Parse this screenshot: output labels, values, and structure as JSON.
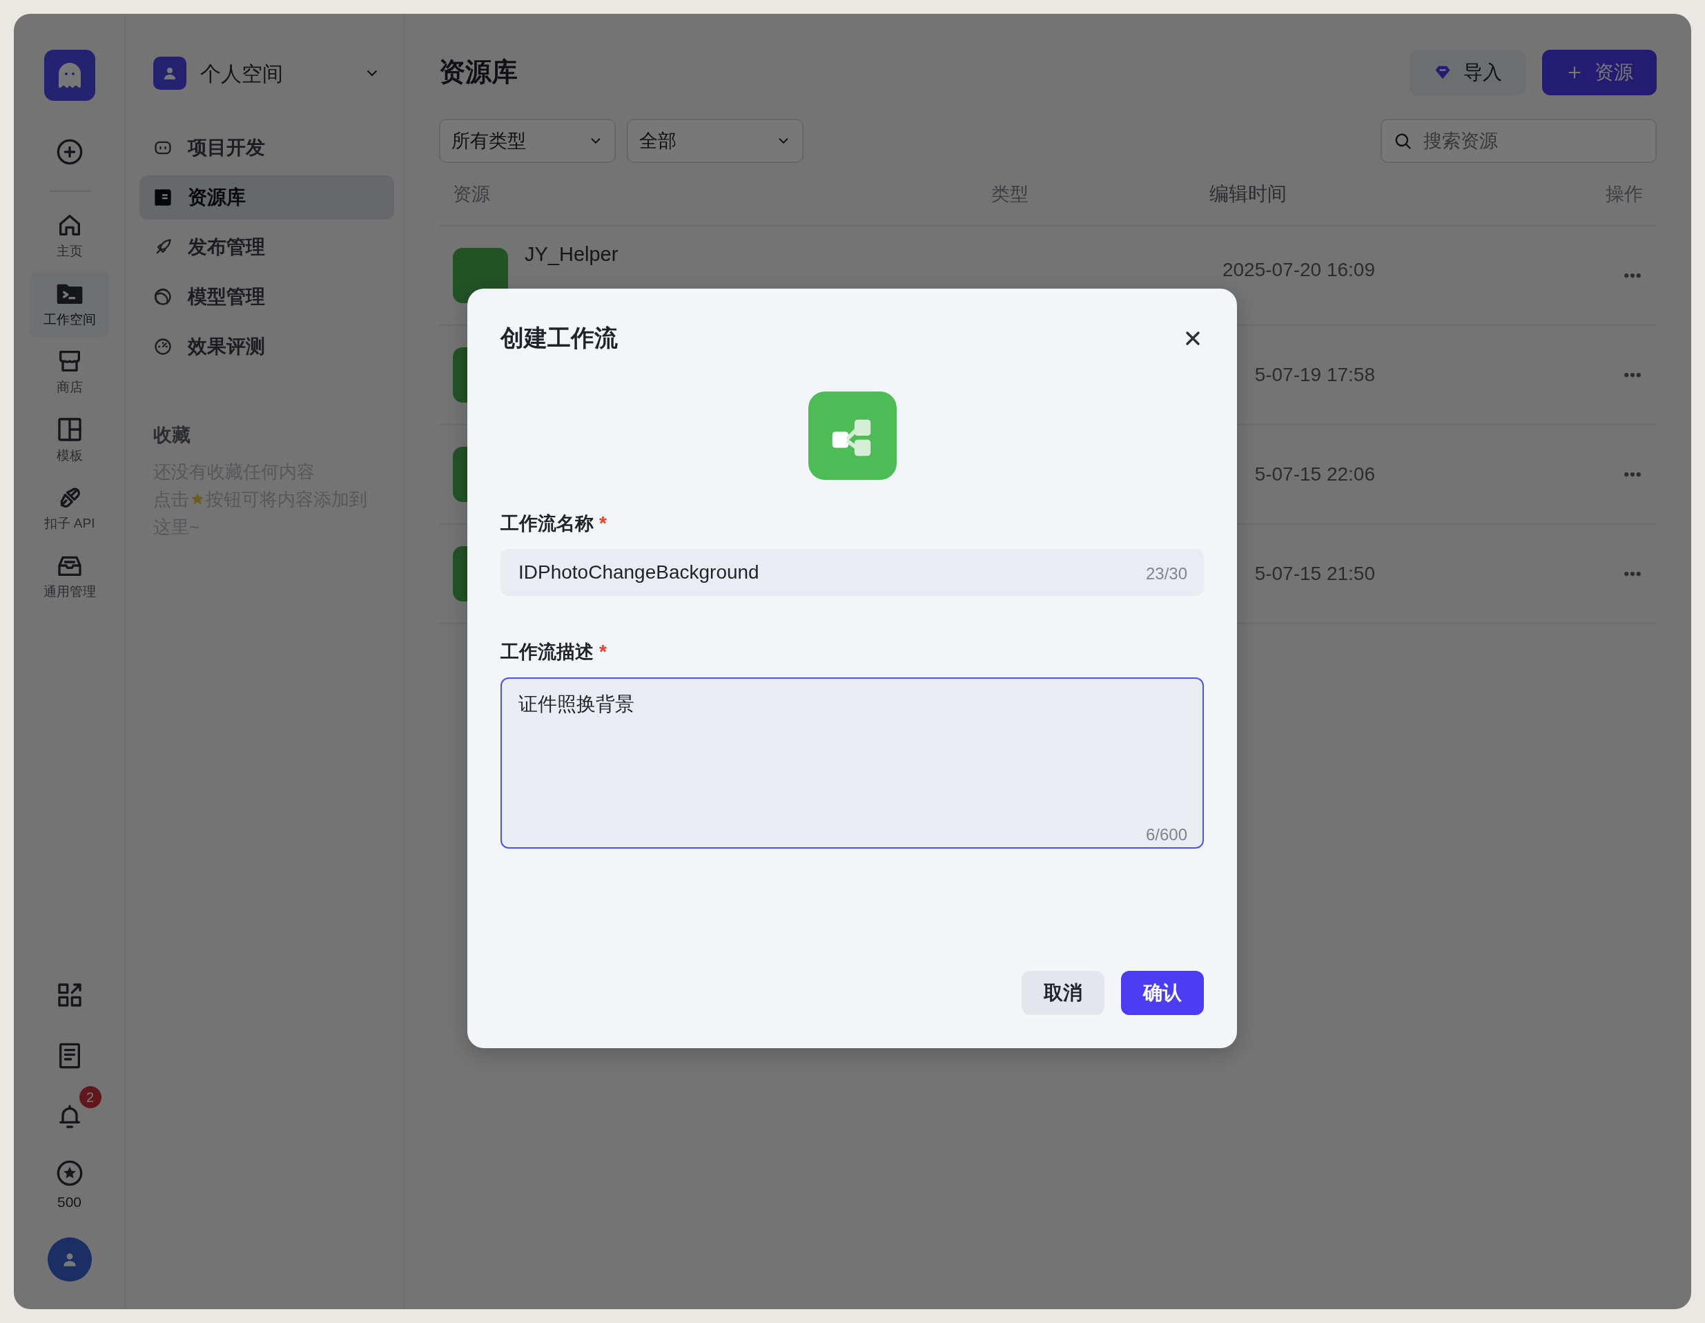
{
  "rail": {
    "items": [
      {
        "label": "主页",
        "selected": false
      },
      {
        "label": "工作空间",
        "selected": true
      },
      {
        "label": "商店",
        "selected": false
      },
      {
        "label": "模板",
        "selected": false
      },
      {
        "label": "扣子 API",
        "selected": false
      },
      {
        "label": "通用管理",
        "selected": false
      }
    ],
    "notification_count": "2",
    "points": "500"
  },
  "sidebar": {
    "workspace": "个人空间",
    "items": [
      {
        "label": "项目开发",
        "selected": false
      },
      {
        "label": "资源库",
        "selected": true
      },
      {
        "label": "发布管理",
        "selected": false
      },
      {
        "label": "模型管理",
        "selected": false
      },
      {
        "label": "效果评测",
        "selected": false
      }
    ],
    "favorites_title": "收藏",
    "favorites_hint": {
      "line_1": "还没有收藏任何内容",
      "before_icon": "点击",
      "after_icon": "按钮可将内容添加到",
      "line_3": "这里~"
    }
  },
  "main": {
    "title": "资源库",
    "import_button": "导入",
    "add_button": "资源",
    "filters": [
      "所有类型",
      "全部"
    ],
    "search": {
      "placeholder": "搜索资源"
    },
    "table": {
      "columns": [
        "资源",
        "类型",
        "编辑时间",
        "操作"
      ],
      "rows": [
        {
          "name": "JY_Helper",
          "time": "2025-07-20 16:09"
        },
        {
          "time": "5-07-19 17:58"
        },
        {
          "time": "5-07-15 22:06"
        },
        {
          "time": "5-07-15 21:50"
        }
      ]
    }
  },
  "modal": {
    "title": "创建工作流",
    "fields": [
      {
        "kind": "input",
        "label": "工作流名称",
        "required_mark": "*",
        "value": "IDPhotoChangeBackground",
        "count": "23/30",
        "focused": false
      },
      {
        "kind": "textarea",
        "label": "工作流描述",
        "required_mark": "*",
        "value": "证件照换背景",
        "count": "6/600",
        "focused": true
      }
    ],
    "cancel_button": "取消",
    "confirm_button": "确认"
  }
}
